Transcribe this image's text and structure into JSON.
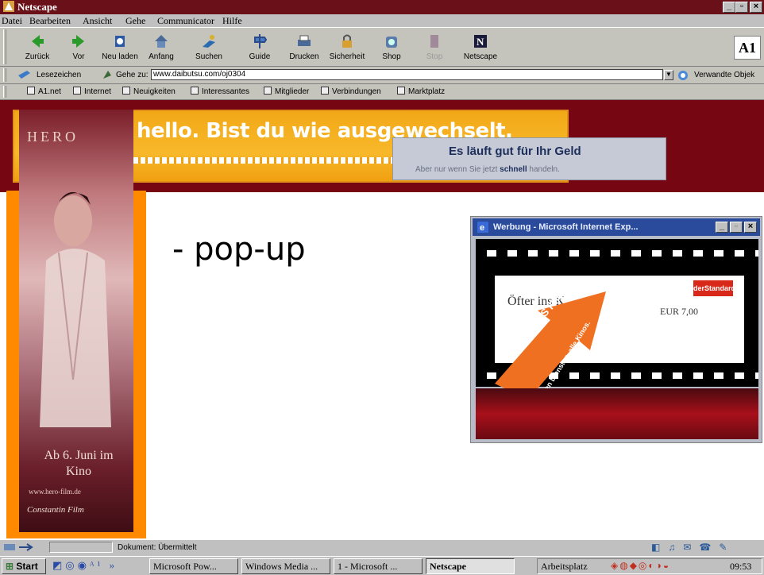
{
  "window": {
    "title": "Netscape"
  },
  "menu": [
    "Datei",
    "Bearbeiten",
    "Ansicht",
    "Gehe",
    "Communicator",
    "Hilfe"
  ],
  "toolbar": {
    "buttons": [
      {
        "label": "Zurück",
        "icon": "back-arrow-icon"
      },
      {
        "label": "Vor",
        "icon": "forward-arrow-icon"
      },
      {
        "label": "Neu laden",
        "icon": "reload-icon"
      },
      {
        "label": "Anfang",
        "icon": "home-icon"
      },
      {
        "label": "Suchen",
        "icon": "search-icon"
      },
      {
        "label": "Guide",
        "icon": "guide-icon"
      },
      {
        "label": "Drucken",
        "icon": "print-icon"
      },
      {
        "label": "Sicherheit",
        "icon": "lock-icon"
      },
      {
        "label": "Shop",
        "icon": "shop-icon"
      },
      {
        "label": "Stop",
        "icon": "stop-icon"
      },
      {
        "label": "Netscape",
        "icon": "netscape-n-icon"
      }
    ],
    "logo": "A1"
  },
  "location": {
    "bookmarks_label": "Lesezeichen",
    "goto_label": "Gehe zu:",
    "url": "www.daibutsu.com/oj0304",
    "related_label": "Verwandte Objek"
  },
  "personal_toolbar": [
    "A1.net",
    "Internet",
    "Neuigkeiten",
    "Interessantes",
    "Mitglieder",
    "Verbindungen",
    "Marktplatz"
  ],
  "ads": {
    "banner_headline": "hello. Bist du wie ausgewechselt.",
    "geld_title": "Es läuft gut für Ihr Geld",
    "geld_sub_a": "Aber nur wenn Sie jetzt ",
    "geld_sub_bold": "schnell",
    "geld_sub_b": " handeln.",
    "hero_title": "HERO",
    "hero_date": "Ab 6. Juni im Kino",
    "hero_url": "www.hero-film.de",
    "hero_sign": "Constantin Film"
  },
  "main": {
    "slide_text": "- pop-up"
  },
  "popup_window": {
    "title": "Werbung - Microsoft Internet Exp...",
    "ticket_left": "Öfter ins K",
    "ticket_price": "EUR 7,00",
    "arrow_text": "UM € 2,- INS KINO.",
    "arrow_sub": "Jeden Dienstag, alle Kinos."
  },
  "statusbar": {
    "text": "Dokument: Übermittelt"
  },
  "taskbar": {
    "start": "Start",
    "tasks": [
      "Microsoft Pow...",
      "Windows Media ...",
      "1 - Microsoft ...",
      "Netscape"
    ],
    "desktop_label": "Arbeitsplatz",
    "clock": "09:53"
  }
}
